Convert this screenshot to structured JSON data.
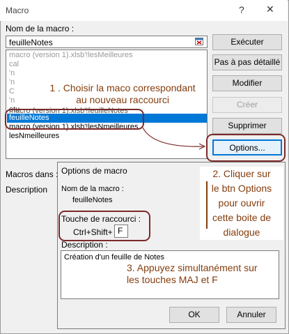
{
  "window": {
    "title": "Macro",
    "help": "?",
    "close": "✕"
  },
  "macro_name_label": "Nom de la macro :",
  "macro_name_value": "feuilleNotes",
  "macro_list": [
    {
      "label": "macro (version 1).xlsb'!lesMeilleures",
      "state": "partial"
    },
    {
      "label": "cal",
      "state": "partial"
    },
    {
      "label": "'n",
      "state": "partial"
    },
    {
      "label": "'n",
      "state": "partial"
    },
    {
      "label": "C",
      "state": "partial"
    },
    {
      "label": "'n",
      "state": "partial"
    },
    {
      "label": "etu",
      "state": "partial"
    },
    {
      "label": "macro (version 1).xlsb'!feuilleNotes",
      "state": "partial"
    },
    {
      "label": "feuilleNotes",
      "state": "selected"
    },
    {
      "label": "macro (version 1).xlsb'!lesNmeilleures",
      "state": "normal"
    },
    {
      "label": "lesNmeilleures",
      "state": "normal"
    }
  ],
  "buttons": {
    "run": "Exécuter",
    "step": "Pas à pas détaillé",
    "edit": "Modifier",
    "create": "Créer",
    "delete": "Supprimer",
    "options": "Options..."
  },
  "macros_in_label": "Macros dans :",
  "description_label": "Description",
  "options_dialog": {
    "title": "Options de macro",
    "name_label": "Nom de la macro :",
    "name_value": "feuilleNotes",
    "shortcut_label": "Touche de raccourci :",
    "shortcut_prefix": "Ctrl+Shift+",
    "shortcut_key": "F",
    "description_label": "Description :",
    "description_value": "Création d'un feuille de Notes",
    "ok": "OK",
    "cancel": "Annuler"
  },
  "annotations": {
    "step1": [
      "1 . Choisir la maco correspondant",
      "au nouveau raccourci"
    ],
    "step2": [
      "2. Cliquer sur",
      "le btn Options",
      "pour ouvrir",
      "cette boite de",
      "dialogue"
    ],
    "step3": [
      "3. Appuyez simultanément sur",
      "les touches MAJ et F"
    ]
  },
  "colors": {
    "annotation": "#843c0c",
    "annotation_box": "#7b2a2a",
    "selection": "#0078d7"
  }
}
